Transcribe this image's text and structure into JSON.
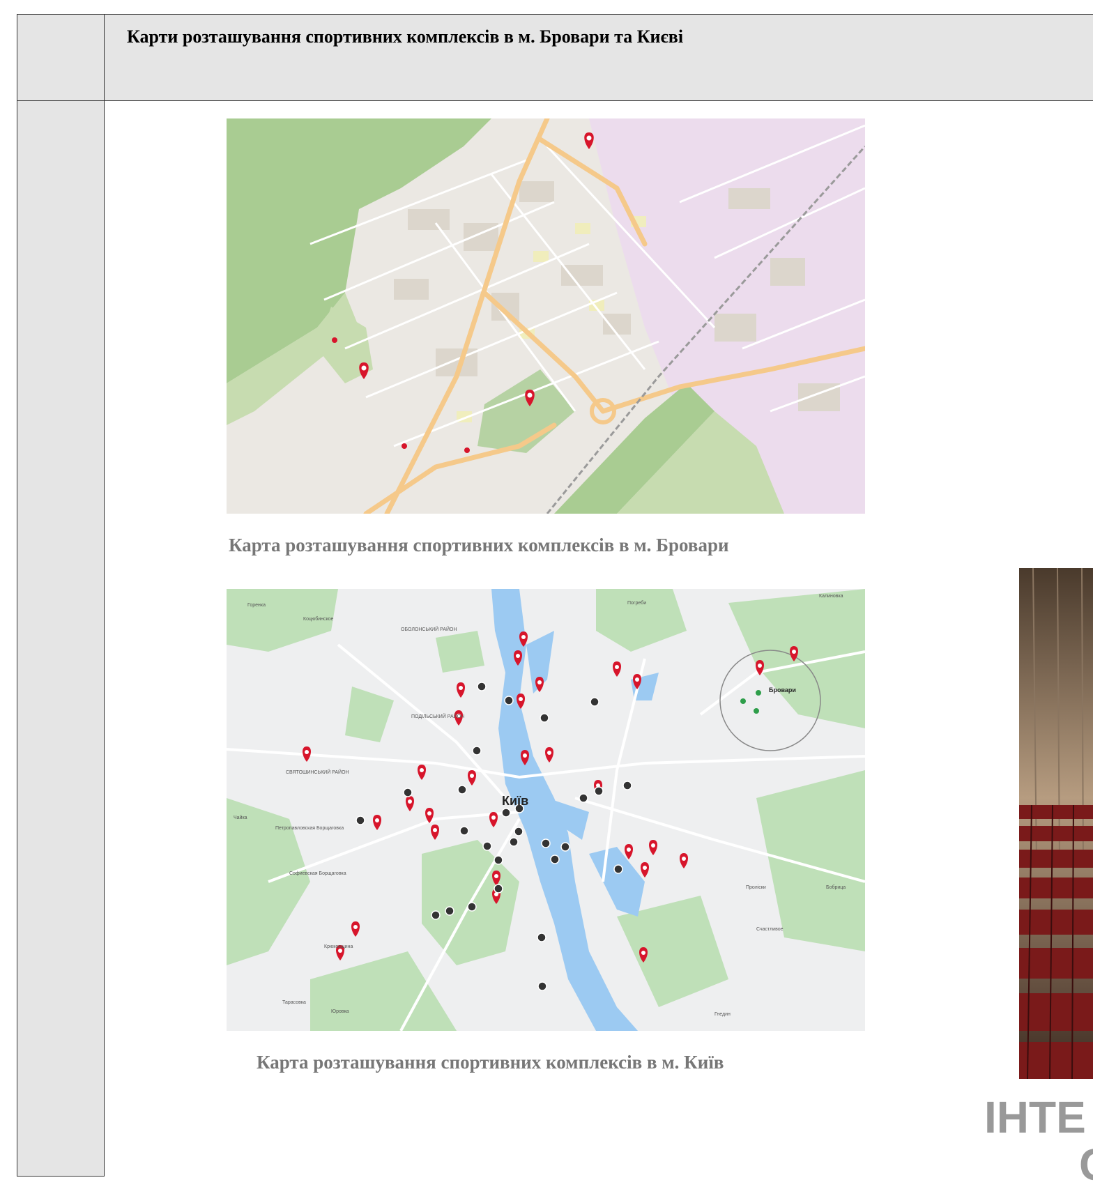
{
  "header": {
    "title": "Карти розташування спортивних комплексів в м. Бровари та Києві"
  },
  "maps": [
    {
      "caption": "Карта розташування спортивних комплексів в м. Бровари",
      "palette": {
        "background": "#ebe8e3",
        "park": "#c7dcb0",
        "forest": "#a9cc92",
        "industrial": "#ecd9ee",
        "road_major": "#f5c98a",
        "road_minor": "#fbfbe0",
        "marker": "#d7152b"
      }
    },
    {
      "caption": "Карта розташування спортивних комплексів в м. Київ",
      "palette": {
        "background": "#eeeff0",
        "park": "#bfe0b8",
        "water": "#9ccaf2",
        "marker": "#d7152b",
        "cluster": "#333333"
      },
      "labels": {
        "city": "Київ",
        "brovary": "Бровари",
        "podilskyi": "ПОДІЛЬСЬКИЙ РАЙОН",
        "obolonskyi": "ОБОЛОНСЬКИЙ РАЙОН",
        "sviatoshynskyi": "СВЯТОШИНСЬКИЙ РАЙОН",
        "petropavlivska": "Петропавловская Борщаговка",
        "sofiivska": "Софиевская Борщаговка",
        "kriukivshchyna": "Крюковщина",
        "tarasivka": "Тарасовка",
        "yurivka": "Юровка",
        "hnidyn": "Гнедин",
        "prolisky": "Проліски",
        "shchaslyve": "Счастливое",
        "bobrytsia": "Бобрица",
        "horenka": "Горенка",
        "kotsiubynske": "Коцюбинское",
        "pohreby": "Погреби",
        "kalynivka": "Калиновка",
        "chaika": "Чайка"
      }
    }
  ],
  "side_photo": {
    "caption_line1": "ІНТЕ",
    "caption_line2": "С"
  }
}
